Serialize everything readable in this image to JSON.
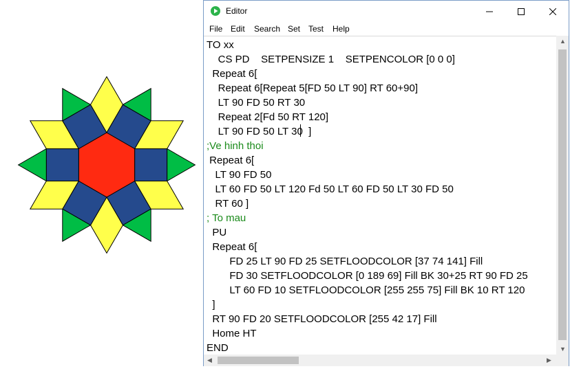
{
  "window": {
    "title": "Editor"
  },
  "menu": [
    "File",
    "Edit",
    "Search",
    "Set",
    "Test",
    "Help"
  ],
  "code_lines": [
    {
      "text": "TO xx",
      "comment": false
    },
    {
      "text": "    CS PD    SETPENSIZE 1    SETPENCOLOR [0 0 0]",
      "comment": false
    },
    {
      "text": "  Repeat 6[",
      "comment": false
    },
    {
      "text": "    Repeat 6[Repeat 5[FD 50 LT 90] RT 60+90]",
      "comment": false
    },
    {
      "text": "    LT 90 FD 50 RT 30",
      "comment": false
    },
    {
      "text": "    Repeat 2[Fd 50 RT 120]",
      "comment": false
    },
    {
      "text": "    LT 90 FD 50 LT 30  ]",
      "comment": false
    },
    {
      "text": ";Ve hinh thoi",
      "comment": true
    },
    {
      "text": " Repeat 6[",
      "comment": false
    },
    {
      "text": "   LT 90 FD 50",
      "comment": false
    },
    {
      "text": "   LT 60 FD 50 LT 120 Fd 50 LT 60 FD 50 LT 30 FD 50",
      "comment": false
    },
    {
      "text": "   RT 60 ]",
      "comment": false
    },
    {
      "text": "; To mau",
      "comment": true
    },
    {
      "text": "  PU",
      "comment": false
    },
    {
      "text": "  Repeat 6[",
      "comment": false
    },
    {
      "text": "        FD 25 LT 90 FD 25 SETFLOODCOLOR [37 74 141] Fill",
      "comment": false
    },
    {
      "text": "        FD 30 SETFLOODCOLOR [0 189 69] Fill BK 30+25 RT 90 FD 25",
      "comment": false
    },
    {
      "text": "        LT 60 FD 10 SETFLOODCOLOR [255 255 75] Fill BK 10 RT 120",
      "comment": false
    },
    {
      "text": "  ]",
      "comment": false
    },
    {
      "text": "  RT 90 FD 20 SETFLOODCOLOR [255 42 17] Fill",
      "comment": false
    },
    {
      "text": "  Home HT",
      "comment": false
    },
    {
      "text": "END",
      "comment": false
    }
  ],
  "colors": {
    "hexagon": "#ff2a11",
    "square": "#254a8d",
    "triangle": "#00bd45",
    "rhombus": "#ffff4b",
    "comment_text": "#1a8a1a"
  }
}
